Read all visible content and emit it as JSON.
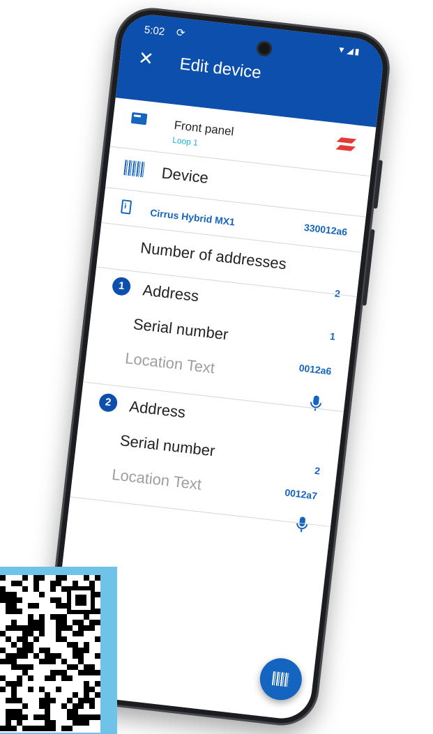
{
  "status_bar": {
    "time": "5:02",
    "sync_icon": "sync-icon",
    "icons": "▼◢▮"
  },
  "app_bar": {
    "close_icon": "close-icon",
    "close_glyph": "✕",
    "title": "Edit device",
    "background_color": "#0d4fad"
  },
  "panel": {
    "title": "Front panel",
    "subtitle": "Loop 1",
    "subtitle_color": "#17b6d4"
  },
  "device": {
    "label": "Device",
    "model": "Cirrus Hybrid MX1",
    "id": "330012a6"
  },
  "number_of_addresses": {
    "label": "Number of addresses",
    "value": "2"
  },
  "addresses": [
    {
      "index": "1",
      "address_label": "Address",
      "address_value": "1",
      "serial_label": "Serial number",
      "serial_value": "0012a6",
      "location_placeholder": "Location Text"
    },
    {
      "index": "2",
      "address_label": "Address",
      "address_value": "2",
      "serial_label": "Serial number",
      "serial_value": "0012a7",
      "location_placeholder": "Location Text"
    }
  ],
  "fab": {
    "icon": "barcode-scan-icon"
  },
  "colors": {
    "accent": "#1565c0",
    "brand_red": "#e53935",
    "qr_frame": "#6fc3e9"
  }
}
